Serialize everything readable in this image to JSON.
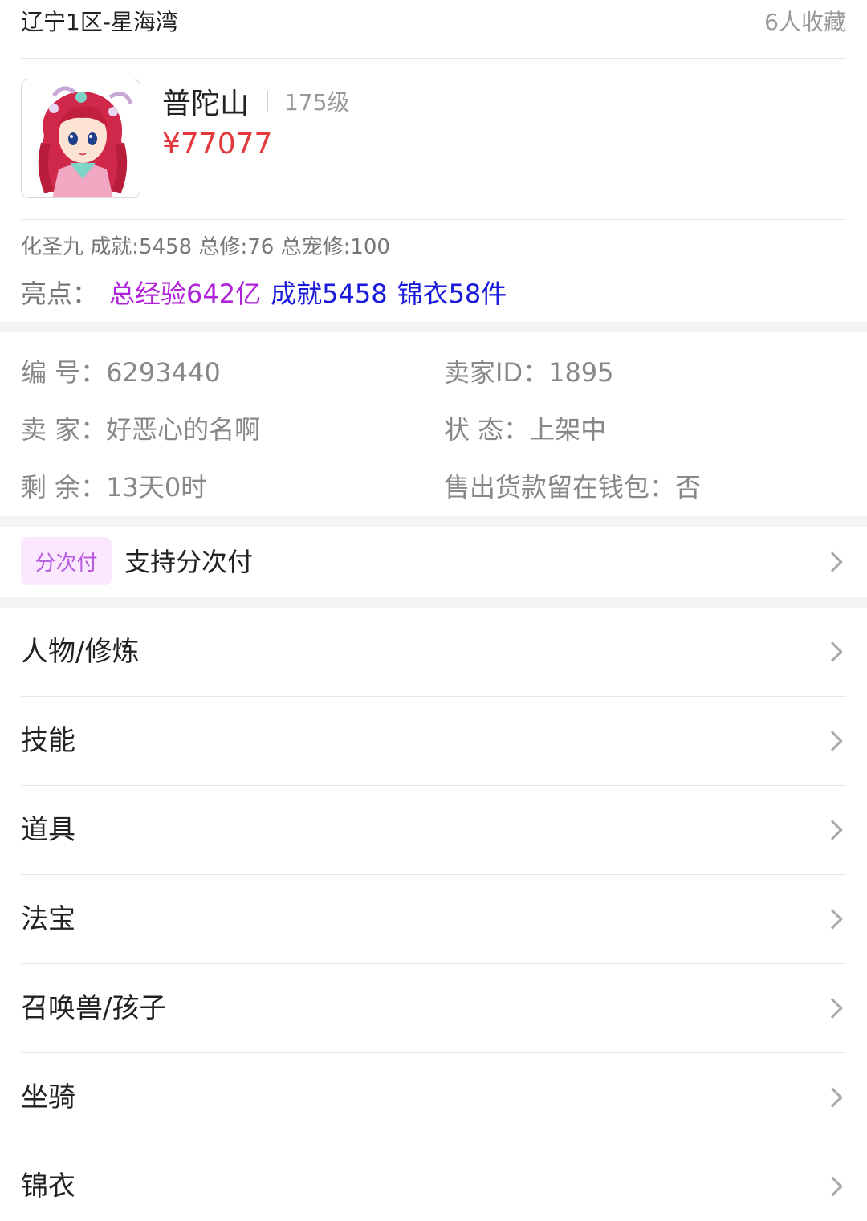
{
  "header": {
    "server": "辽宁1区-星海湾",
    "favorites": "6人收藏"
  },
  "character": {
    "school": "普陀山",
    "level": "175级",
    "price": "¥77077",
    "stats": "化圣九 成就:5458 总修:76 总宠修:100",
    "highlights_label": "亮点：",
    "highlights": [
      "总经验642亿",
      "成就5458",
      "锦衣58件"
    ],
    "highlight_colors": [
      "#b022d9",
      "#1a1adb",
      "#1a1adb"
    ],
    "price_color": "#e4393c"
  },
  "info": {
    "serial": "编  号：6293440",
    "seller_id": "卖家ID：1895",
    "seller": "卖  家：好恶心的名啊",
    "status": "状  态：上架中",
    "remaining": "剩  余：13天0时",
    "wallet": "售出货款留在钱包：否"
  },
  "installment": {
    "badge": "分次付",
    "text": "支持分次付"
  },
  "menu": [
    {
      "label": "人物/修炼"
    },
    {
      "label": "技能"
    },
    {
      "label": "道具"
    },
    {
      "label": "法宝"
    },
    {
      "label": "召唤兽/孩子"
    },
    {
      "label": "坐骑"
    },
    {
      "label": "锦衣"
    }
  ]
}
